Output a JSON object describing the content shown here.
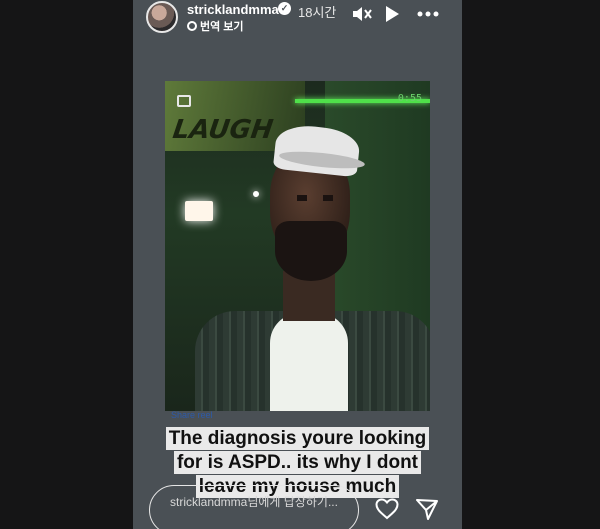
{
  "story": {
    "username": "stricklandmma",
    "time_ago": "18시간",
    "translate_label": "번역 보기",
    "video_timer": "0:55",
    "video_link": "Share reel",
    "sign_text": "LAUGH"
  },
  "caption": {
    "lines": [
      "The diagnosis youre looking",
      "for is ASPD.. its why I dont",
      "leave my house much"
    ]
  },
  "reply": {
    "placeholder": "stricklandmma님에게 답장하기..."
  },
  "icons": {
    "verified": "verified-badge-icon",
    "mute": "speaker-muted-icon",
    "play": "play-icon",
    "more": "more-dots-icon",
    "heart": "heart-icon",
    "send": "send-icon"
  },
  "colors": {
    "story_bg": "#4a5055",
    "page_bg": "#151516",
    "caption_bg": "#e9e9e9",
    "neon": "#4fe04a"
  }
}
